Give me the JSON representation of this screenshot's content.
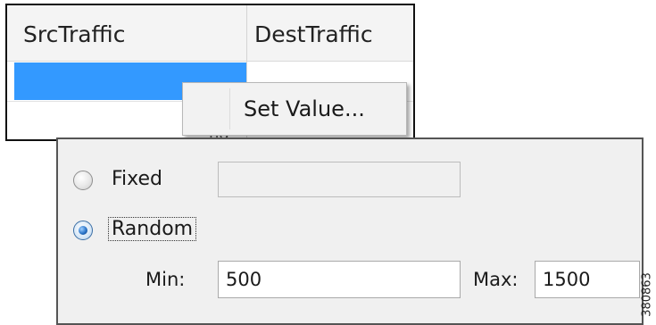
{
  "table": {
    "columns": [
      "SrcTraffic",
      "DestTraffic"
    ],
    "cell_fragment": "nd"
  },
  "context_menu": {
    "items": [
      {
        "label": "Set Value..."
      }
    ]
  },
  "value_dialog": {
    "fixed": {
      "label": "Fixed",
      "selected": false,
      "value": ""
    },
    "random": {
      "label": "Random",
      "selected": true
    },
    "min": {
      "label": "Min:",
      "value": "500"
    },
    "max": {
      "label": "Max:",
      "value": "1500"
    }
  },
  "figure_id": "380863",
  "colors": {
    "selection": "#3399ff",
    "panel_bg": "#f0f0f0",
    "header_bg": "#f4f4f4"
  }
}
